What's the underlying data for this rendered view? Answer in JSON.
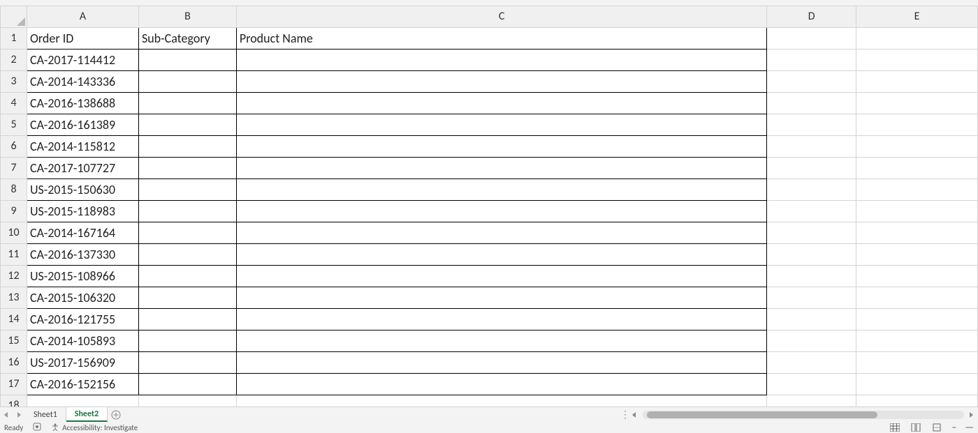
{
  "columns": [
    "A",
    "B",
    "C",
    "D",
    "E"
  ],
  "headers": {
    "A": "Order ID",
    "B": "Sub-Category",
    "C": "Product Name"
  },
  "rows": [
    {
      "n": 1
    },
    {
      "n": 2,
      "A": "CA-2017-114412"
    },
    {
      "n": 3,
      "A": "CA-2014-143336"
    },
    {
      "n": 4,
      "A": "CA-2016-138688"
    },
    {
      "n": 5,
      "A": "CA-2016-161389"
    },
    {
      "n": 6,
      "A": "CA-2014-115812"
    },
    {
      "n": 7,
      "A": "CA-2017-107727"
    },
    {
      "n": 8,
      "A": "US-2015-150630"
    },
    {
      "n": 9,
      "A": "US-2015-118983"
    },
    {
      "n": 10,
      "A": "CA-2014-167164"
    },
    {
      "n": 11,
      "A": "CA-2016-137330"
    },
    {
      "n": 12,
      "A": "US-2015-108966"
    },
    {
      "n": 13,
      "A": "CA-2015-106320"
    },
    {
      "n": 14,
      "A": "CA-2016-121755"
    },
    {
      "n": 15,
      "A": "CA-2014-105893"
    },
    {
      "n": 16,
      "A": "US-2017-156909"
    },
    {
      "n": 17,
      "A": "CA-2016-152156"
    },
    {
      "n": 18
    }
  ],
  "boxed_range": {
    "cols": [
      "A",
      "B",
      "C"
    ],
    "row_start": 1,
    "row_end": 17
  },
  "tabs": {
    "items": [
      "Sheet1",
      "Sheet2"
    ],
    "active_index": 1
  },
  "status": {
    "ready": "Ready",
    "accessibility": "Accessibility: Investigate"
  }
}
